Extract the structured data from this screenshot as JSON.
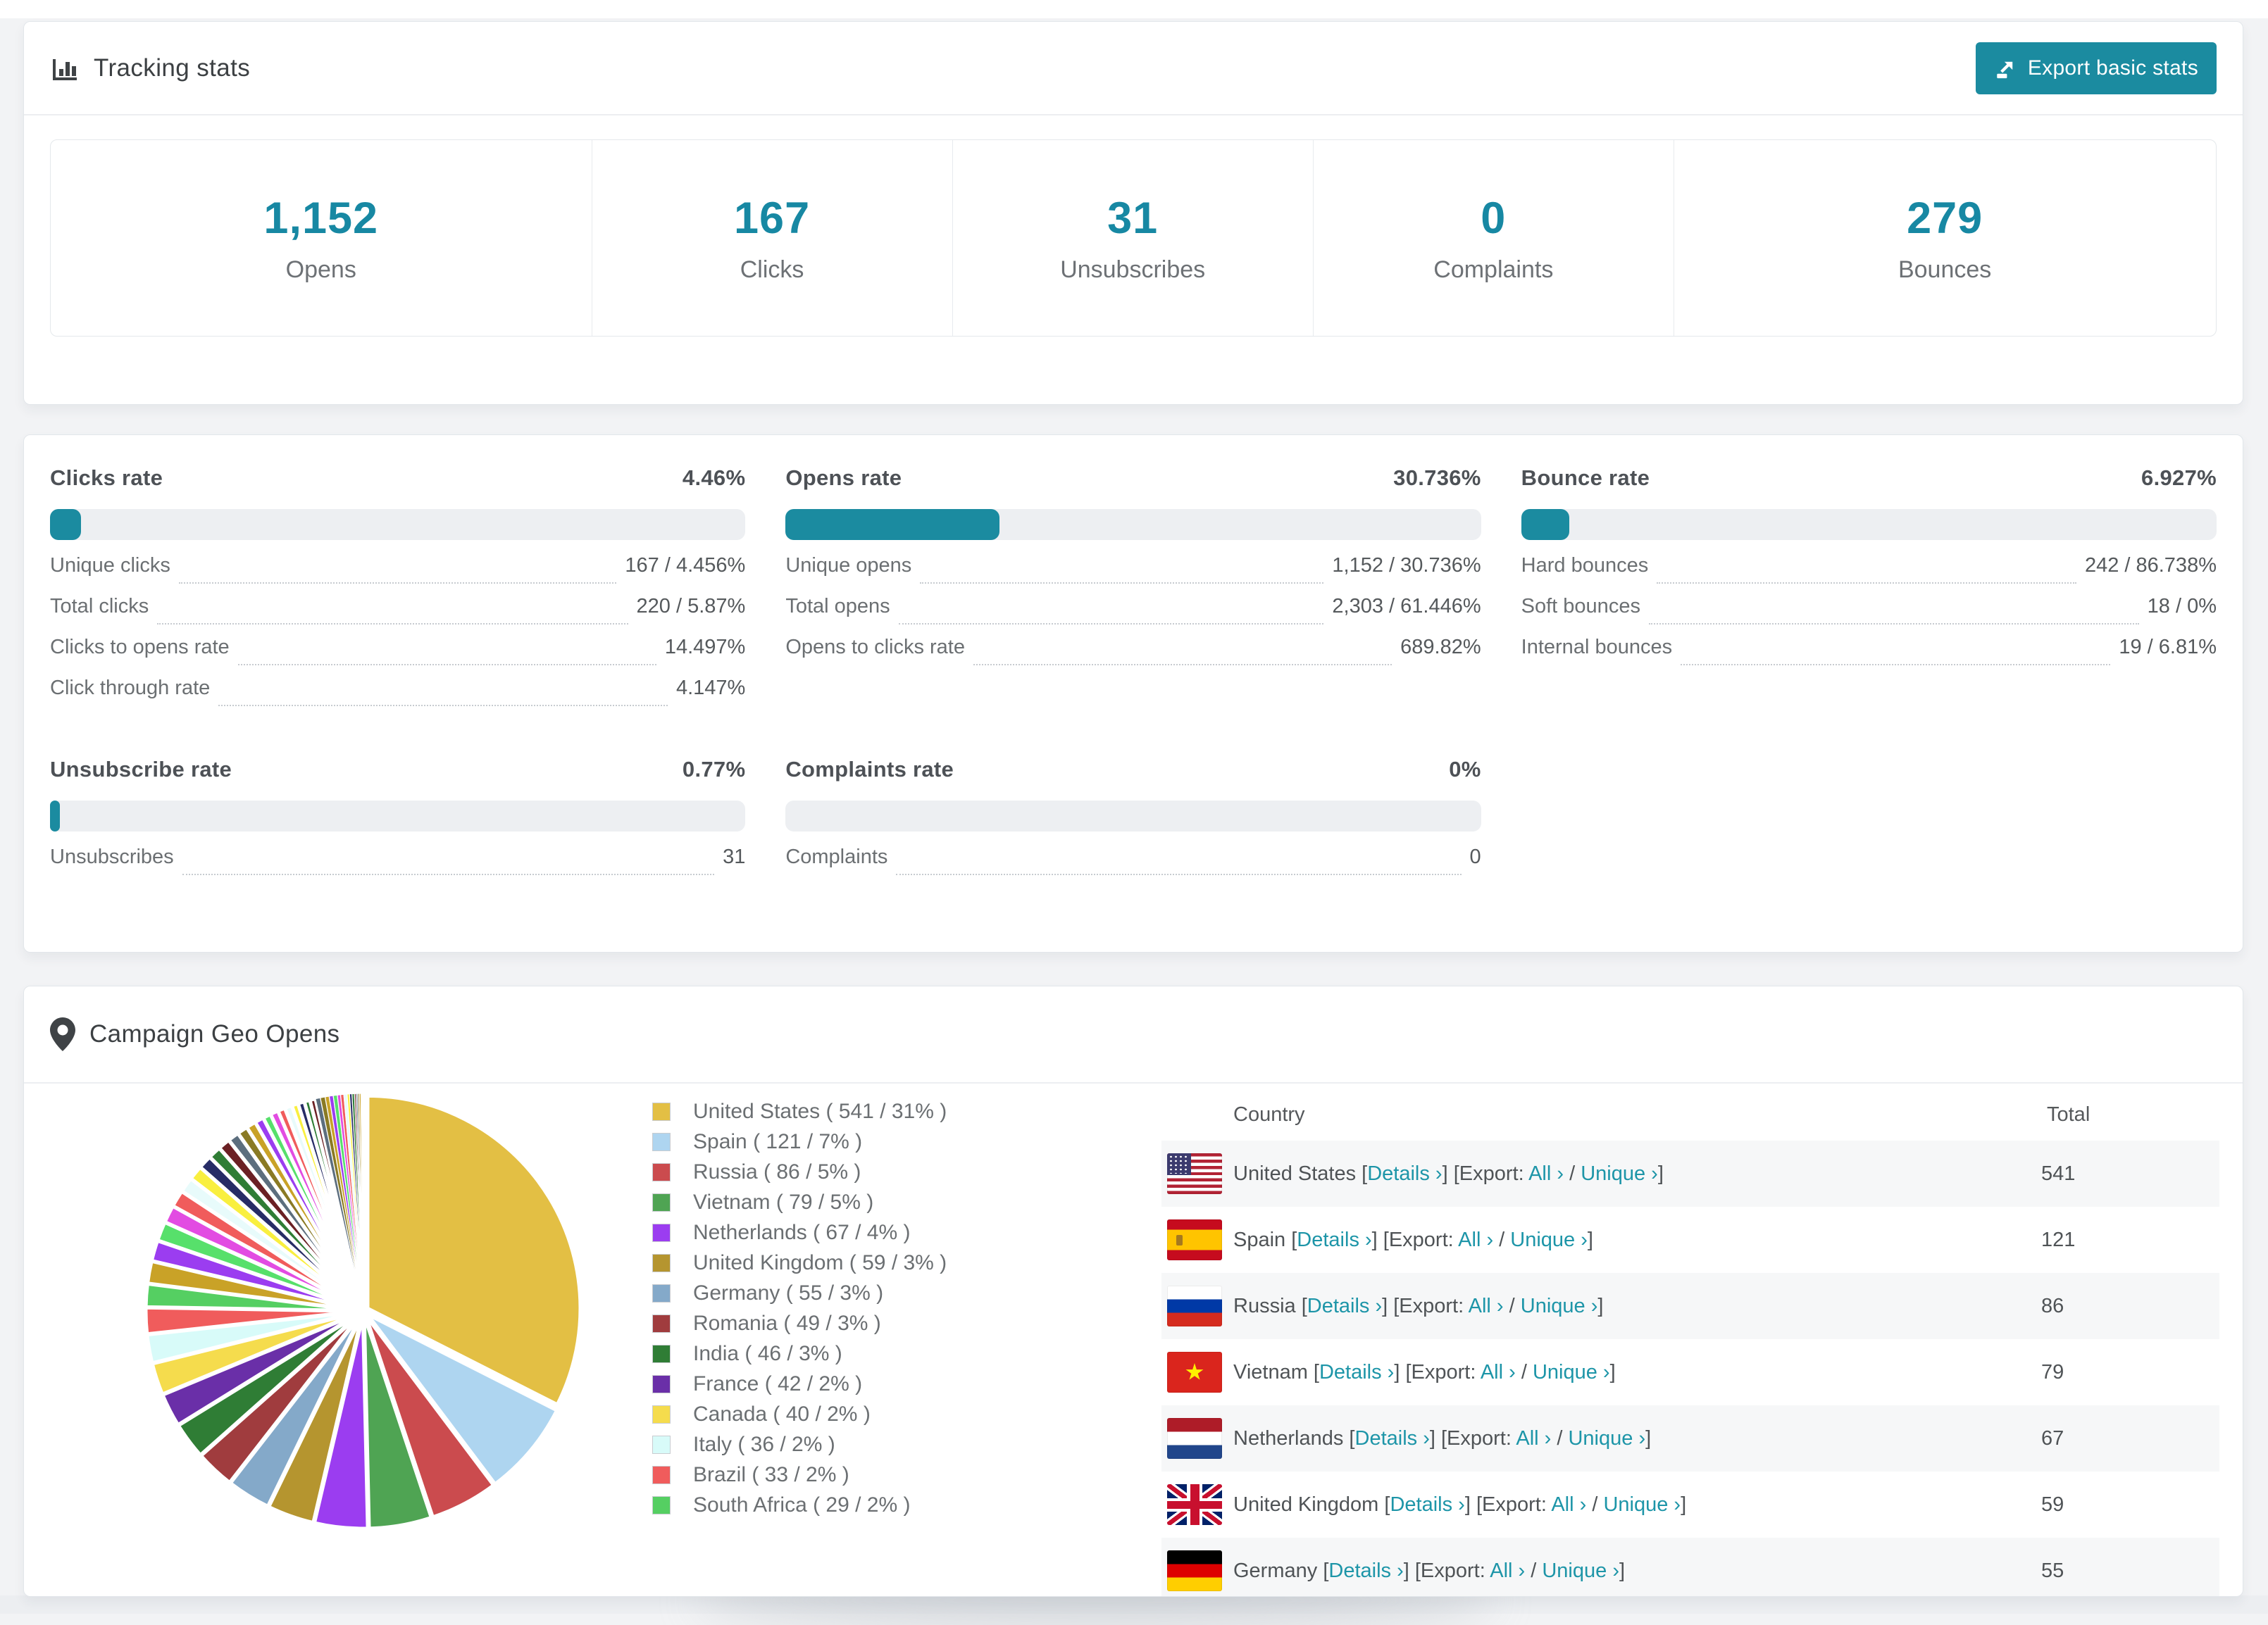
{
  "accent_color": "#1b8ba0",
  "tracking": {
    "title": "Tracking stats",
    "export_button": "Export basic stats",
    "stats": [
      {
        "value": "1,152",
        "label": "Opens"
      },
      {
        "value": "167",
        "label": "Clicks"
      },
      {
        "value": "31",
        "label": "Unsubscribes"
      },
      {
        "value": "0",
        "label": "Complaints"
      },
      {
        "value": "279",
        "label": "Bounces"
      }
    ]
  },
  "rates": [
    {
      "title": "Clicks rate",
      "value": "4.46%",
      "pct": 4.46,
      "rows": [
        {
          "label": "Unique clicks",
          "value": "167 / 4.456%"
        },
        {
          "label": "Total clicks",
          "value": "220 / 5.87%"
        },
        {
          "label": "Clicks to opens rate",
          "value": "14.497%"
        },
        {
          "label": "Click through rate",
          "value": "4.147%"
        }
      ]
    },
    {
      "title": "Opens rate",
      "value": "30.736%",
      "pct": 30.736,
      "rows": [
        {
          "label": "Unique opens",
          "value": "1,152 / 30.736%"
        },
        {
          "label": "Total opens",
          "value": "2,303 / 61.446%"
        },
        {
          "label": "Opens to clicks rate",
          "value": "689.82%"
        }
      ]
    },
    {
      "title": "Bounce rate",
      "value": "6.927%",
      "pct": 6.927,
      "rows": [
        {
          "label": "Hard bounces",
          "value": "242 / 86.738%"
        },
        {
          "label": "Soft bounces",
          "value": "18 / 0%"
        },
        {
          "label": "Internal bounces",
          "value": "19 / 6.81%"
        }
      ]
    },
    {
      "title": "Unsubscribe rate",
      "value": "0.77%",
      "pct": 0.77,
      "rows": [
        {
          "label": "Unsubscribes",
          "value": "31"
        }
      ]
    },
    {
      "title": "Complaints rate",
      "value": "0%",
      "pct": 0,
      "rows": [
        {
          "label": "Complaints",
          "value": "0"
        }
      ]
    }
  ],
  "geo": {
    "title": "Campaign Geo Opens",
    "legend": [
      "United States ( 541 / 31% )",
      "Spain ( 121 / 7% )",
      "Russia ( 86 / 5% )",
      "Vietnam ( 79 / 5% )",
      "Netherlands ( 67 / 4% )",
      "United Kingdom ( 59 / 3% )",
      "Germany ( 55 / 3% )",
      "Romania ( 49 / 3% )",
      "India ( 46 / 3% )",
      "France ( 42 / 2% )",
      "Canada ( 40 / 2% )",
      "Italy ( 36 / 2% )",
      "Brazil ( 33 / 2% )",
      "South Africa ( 29 / 2% )"
    ],
    "table": {
      "columns": [
        "Country",
        "Total"
      ],
      "link_labels": {
        "details": "Details ›",
        "export_prefix": "Export:",
        "all": "All ›",
        "unique": "Unique ›"
      },
      "rows": [
        {
          "country": "United States",
          "flag": "us",
          "total": "541"
        },
        {
          "country": "Spain",
          "flag": "es",
          "total": "121"
        },
        {
          "country": "Russia",
          "flag": "ru",
          "total": "86"
        },
        {
          "country": "Vietnam",
          "flag": "vn",
          "total": "79"
        },
        {
          "country": "Netherlands",
          "flag": "nl",
          "total": "67"
        },
        {
          "country": "United Kingdom",
          "flag": "gb",
          "total": "59"
        },
        {
          "country": "Germany",
          "flag": "de",
          "total": "55"
        }
      ]
    }
  },
  "chart_data": {
    "type": "pie",
    "title": "Campaign Geo Opens",
    "legend_position": "right",
    "start_angle_deg": -90,
    "direction": "clockwise",
    "categories": [
      "United States",
      "Spain",
      "Russia",
      "Vietnam",
      "Netherlands",
      "United Kingdom",
      "Germany",
      "Romania",
      "India",
      "France",
      "Canada",
      "Italy",
      "Brazil",
      "South Africa"
    ],
    "values": [
      541,
      121,
      86,
      79,
      67,
      59,
      55,
      49,
      46,
      42,
      40,
      36,
      33,
      29
    ],
    "percent_labels": [
      31,
      7,
      5,
      5,
      4,
      3,
      3,
      3,
      3,
      2,
      2,
      2,
      2,
      2
    ],
    "colors": [
      "#e3bf44",
      "#aed5f0",
      "#cb4b4e",
      "#4fa453",
      "#9b3df0",
      "#b5952f",
      "#84a9c9",
      "#a03c3e",
      "#2f7d35",
      "#6a2fa8",
      "#f5dc4d",
      "#d8fbf9",
      "#f05c5c",
      "#55cf62"
    ],
    "unlabeled_small_slices": {
      "values": [
        28,
        26,
        24,
        22,
        21,
        19,
        18,
        17,
        16,
        15,
        14,
        13,
        12,
        11,
        10,
        10,
        9,
        9,
        8,
        8,
        7,
        7,
        6,
        6,
        5,
        5,
        5,
        4,
        4,
        4,
        3,
        3,
        3,
        2,
        2,
        2,
        2,
        1,
        1,
        1
      ],
      "colors": [
        "#c9a227",
        "#9b3df0",
        "#57e06b",
        "#e24ce2",
        "#f05c5c",
        "#e8fbfb",
        "#f9ef3f",
        "#272c66",
        "#2f7d35",
        "#6b2024",
        "#5c6e7e",
        "#8a7a24"
      ]
    }
  }
}
